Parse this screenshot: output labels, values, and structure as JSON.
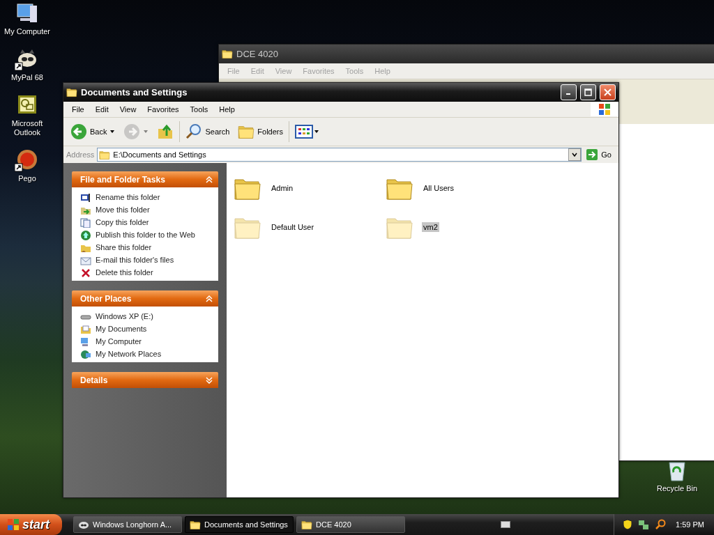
{
  "desktop_icons": [
    {
      "label": "My Computer",
      "kind": "computer",
      "shortcut": false
    },
    {
      "label": "MyPal 68",
      "kind": "raccoon",
      "shortcut": true
    },
    {
      "label": "Microsoft Outlook",
      "kind": "outlook",
      "shortcut": false
    },
    {
      "label": "Pego",
      "kind": "orb",
      "shortcut": true
    }
  ],
  "recycle_bin": {
    "label": "Recycle Bin"
  },
  "background_window": {
    "title": "DCE 4020",
    "active": false,
    "menu": [
      "File",
      "Edit",
      "View",
      "Favorites",
      "Tools",
      "Help"
    ]
  },
  "window": {
    "title": "Documents and Settings",
    "active": true,
    "menu": [
      "File",
      "Edit",
      "View",
      "Favorites",
      "Tools",
      "Help"
    ],
    "toolbar": [
      {
        "kind": "back",
        "label": "Back",
        "disabled": false
      },
      {
        "kind": "forward",
        "disabled": true
      },
      {
        "kind": "up",
        "disabled": false
      },
      {
        "kind": "search",
        "label": "Search",
        "disabled": false
      },
      {
        "kind": "folders",
        "label": "Folders",
        "disabled": false
      },
      {
        "kind": "views",
        "disabled": false
      }
    ],
    "address": {
      "label": "Address",
      "value": "E:\\Documents and Settings",
      "go": "Go"
    },
    "task_panes": [
      {
        "title": "File and Folder Tasks",
        "expanded": true,
        "items": [
          {
            "label": "Rename this folder",
            "kind": "rename"
          },
          {
            "label": "Move this folder",
            "kind": "move"
          },
          {
            "label": "Copy this folder",
            "kind": "copy"
          },
          {
            "label": "Publish this folder to the Web",
            "kind": "publish"
          },
          {
            "label": "Share this folder",
            "kind": "share"
          },
          {
            "label": "E-mail this folder's files",
            "kind": "email"
          },
          {
            "label": "Delete this folder",
            "kind": "delete"
          }
        ]
      },
      {
        "title": "Other Places",
        "expanded": true,
        "items": [
          {
            "label": "Windows XP (E:)",
            "kind": "drive"
          },
          {
            "label": "My Documents",
            "kind": "documents"
          },
          {
            "label": "My Computer",
            "kind": "computer"
          },
          {
            "label": "My Network Places",
            "kind": "network"
          }
        ]
      },
      {
        "title": "Details",
        "expanded": false
      }
    ],
    "folders": [
      {
        "name": "Admin",
        "hidden": false,
        "selected": false
      },
      {
        "name": "All Users",
        "hidden": false,
        "selected": false
      },
      {
        "name": "Default User",
        "hidden": true,
        "selected": false
      },
      {
        "name": "vm2",
        "hidden": true,
        "selected": true
      }
    ]
  },
  "taskbar": {
    "start": "start",
    "tasks": [
      {
        "label": "Windows Longhorn A...",
        "kind": "app",
        "selected": false
      },
      {
        "label": "Documents and Settings",
        "kind": "folder",
        "selected": true
      },
      {
        "label": "DCE 4020",
        "kind": "folder",
        "selected": false
      }
    ],
    "clock": "1:59 PM"
  }
}
